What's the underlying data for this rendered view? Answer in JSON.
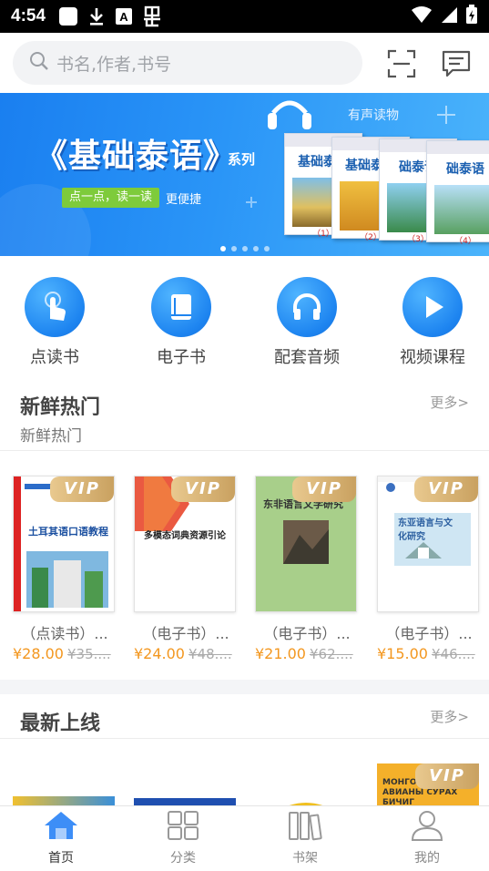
{
  "status_bar": {
    "time": "4:54"
  },
  "search": {
    "placeholder": "书名,作者,书号"
  },
  "banner": {
    "title": "《基础泰语》",
    "series": "系列",
    "tag": "点一点，读一读",
    "tag_suffix": "更便捷",
    "audio_label": "有声读物",
    "book_names": [
      "基础泰语",
      "基础泰语",
      "础泰语",
      "础泰语"
    ],
    "book_numbers": [
      "（1）",
      "（2）",
      "（3）",
      "（4）"
    ],
    "slides": 5,
    "active_slide": 0
  },
  "categories": [
    {
      "label": "点读书",
      "icon": "touch-icon"
    },
    {
      "label": "电子书",
      "icon": "ebook-icon"
    },
    {
      "label": "配套音频",
      "icon": "headphones-icon"
    },
    {
      "label": "视频课程",
      "icon": "play-icon"
    }
  ],
  "sections": {
    "hot": {
      "title": "新鲜热门",
      "subtitle": "新鲜热门",
      "more": "更多>"
    },
    "new": {
      "title": "最新上线",
      "more": "更多>"
    }
  },
  "products": [
    {
      "badge": "VIP",
      "type": "（点读书）...",
      "price": "¥28.00",
      "old_price": "¥35....",
      "cover_title": "土耳其语口语教程"
    },
    {
      "badge": "VIP",
      "type": "（电子书）...",
      "price": "¥24.00",
      "old_price": "¥48....",
      "cover_title": "多模态词典资源引论"
    },
    {
      "badge": "VIP",
      "type": "（电子书）...",
      "price": "¥21.00",
      "old_price": "¥62....",
      "cover_title": "东非语言文学研究"
    },
    {
      "badge": "VIP",
      "type": "（电子书）...",
      "price": "¥15.00",
      "old_price": "¥46....",
      "cover_title": "东亚语言与文化研究"
    }
  ],
  "new_products": [
    {
      "badge": "VIP",
      "cover_title": "МОНГОЛ ... АВИАНЫ СУРАХ БИЧИГ"
    }
  ],
  "bottom_nav": [
    {
      "label": "首页",
      "icon": "home-icon",
      "active": true
    },
    {
      "label": "分类",
      "icon": "category-icon",
      "active": false
    },
    {
      "label": "书架",
      "icon": "bookshelf-icon",
      "active": false
    },
    {
      "label": "我的",
      "icon": "profile-icon",
      "active": false
    }
  ],
  "colors": {
    "accent": "#1d84f0",
    "price": "#f3971f",
    "vip_gold": "#d4ad6b"
  }
}
